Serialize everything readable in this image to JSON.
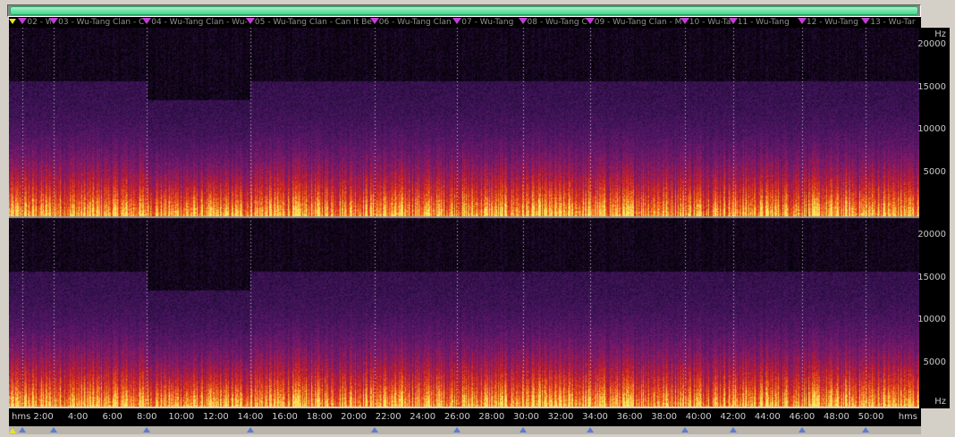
{
  "timeline": {
    "scroll_thumb": "horizontal-scroll-thumb",
    "tracks": [
      {
        "label": "02 - Wu",
        "start_min": 0.8
      },
      {
        "label": "03 - Wu-Tang Clan - C",
        "start_min": 2.6
      },
      {
        "label": "04 - Wu-Tang Clan - Wu-",
        "start_min": 8.0
      },
      {
        "label": "05 - Wu-Tang Clan - Can It Be",
        "start_min": 14.0
      },
      {
        "label": "06 - Wu-Tang Clan",
        "start_min": 21.2
      },
      {
        "label": "07 - Wu-Tang",
        "start_min": 26.0
      },
      {
        "label": "08 - Wu-Tang Cl",
        "start_min": 29.8
      },
      {
        "label": "09 - Wu-Tang Clan - Me",
        "start_min": 33.7
      },
      {
        "label": "10 - Wu-Ta",
        "start_min": 39.2
      },
      {
        "label": "11 - Wu-Tang",
        "start_min": 42.0
      },
      {
        "label": "12 - Wu-Tang",
        "start_min": 46.0
      },
      {
        "label": "13 - Wu-Tar",
        "start_min": 49.7
      }
    ],
    "total_min": 52.8
  },
  "freq_axis": {
    "unit": "Hz",
    "ticks_top": [
      "20000",
      "15000",
      "10000",
      "5000"
    ],
    "ticks_bottom": [
      "20000",
      "15000",
      "10000",
      "5000"
    ],
    "bottom_unit": "Hz"
  },
  "time_axis": {
    "unit_left": "hms",
    "unit_right": "hms",
    "ticks": [
      "2:00",
      "4:00",
      "6:00",
      "8:00",
      "10:00",
      "12:00",
      "14:00",
      "16:00",
      "18:00",
      "20:00",
      "22:00",
      "24:00",
      "26:00",
      "28:00",
      "30:00",
      "32:00",
      "34:00",
      "36:00",
      "38:00",
      "40:00",
      "42:00",
      "44:00",
      "46:00",
      "48:00",
      "50:00"
    ]
  },
  "colors": {
    "background": "#000000",
    "hot": "#ffd23c",
    "mid": "#d4261a",
    "cool": "#4b1a6b",
    "marker": "#c23fd6",
    "scroll": "#3fd68c"
  }
}
